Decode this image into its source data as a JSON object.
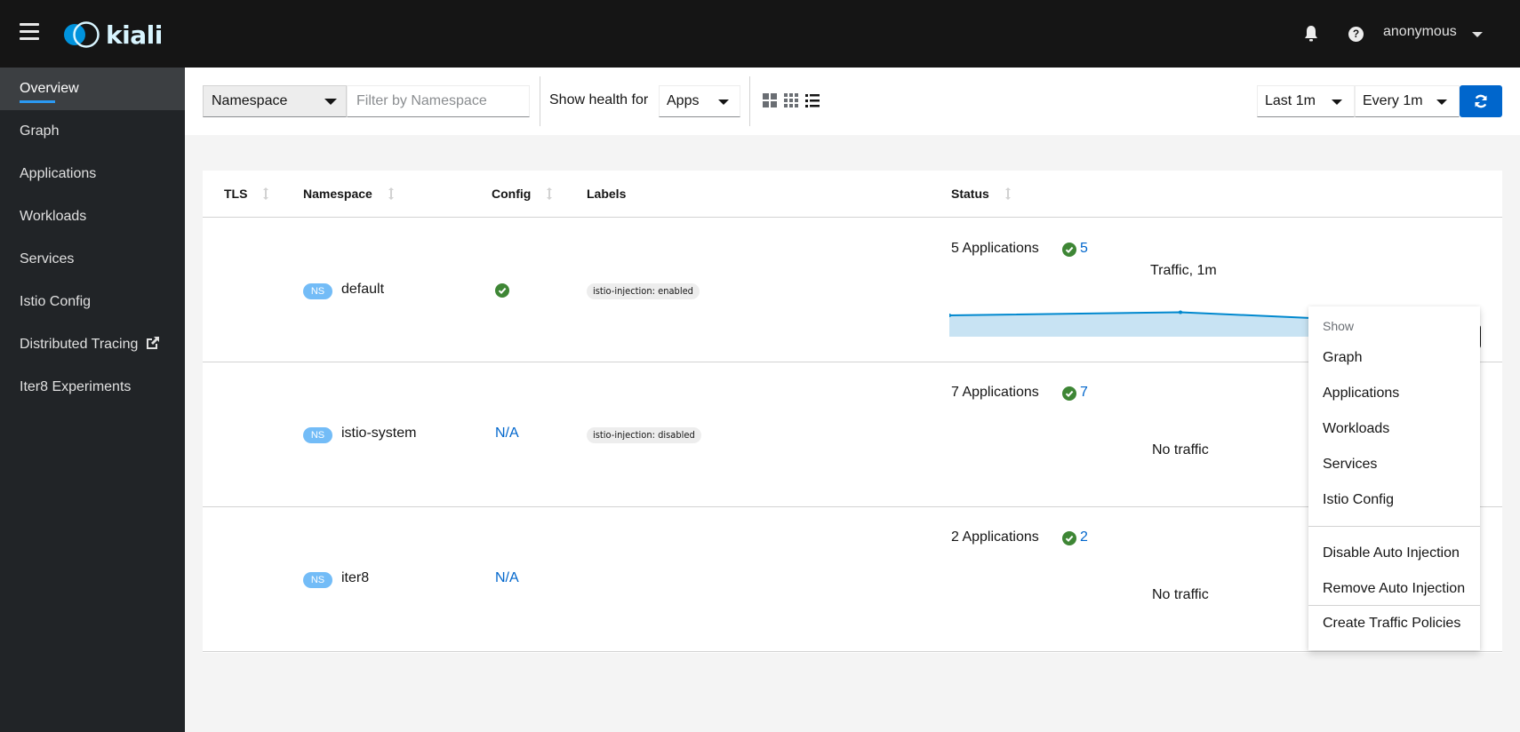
{
  "header": {
    "brand": "kiali",
    "user": "anonymous",
    "icons": [
      "hamburger-menu-icon",
      "kiali-logo",
      "bell-icon",
      "help-icon",
      "caret-down-icon"
    ]
  },
  "sidebar": {
    "items": [
      {
        "label": "Overview",
        "active": true
      },
      {
        "label": "Graph"
      },
      {
        "label": "Applications"
      },
      {
        "label": "Workloads"
      },
      {
        "label": "Services"
      },
      {
        "label": "Istio Config"
      },
      {
        "label": "Distributed Tracing",
        "icon": "external-link-icon"
      },
      {
        "label": "Iter8 Experiments"
      }
    ]
  },
  "toolbar": {
    "filter_type": "Namespace",
    "filter_placeholder": "Filter by Namespace",
    "filter_value": "",
    "health_label": "Show health for",
    "health_type": "Apps",
    "view_modes": [
      "expand-view-icon",
      "compact-view-icon",
      "list-view-icon"
    ],
    "duration": "Last 1m",
    "refresh_interval": "Every 1m",
    "refresh_icon": "sync-icon"
  },
  "table": {
    "columns": [
      "TLS",
      "Namespace",
      "Config",
      "Labels",
      "Status"
    ],
    "rows": [
      {
        "badge": "NS",
        "namespace": "default",
        "tls": "",
        "config": "ok",
        "config_text": "",
        "label": "istio-injection: enabled",
        "apps": "5 Applications",
        "healthy": "5",
        "traffic_title": "Traffic, 1m",
        "traffic_text": "",
        "has_chart": true
      },
      {
        "badge": "NS",
        "namespace": "istio-system",
        "tls": "",
        "config": "na",
        "config_text": "N/A",
        "label": "istio-injection: disabled",
        "apps": "7 Applications",
        "healthy": "7",
        "traffic_title": "",
        "traffic_text": "No traffic",
        "has_chart": false
      },
      {
        "badge": "NS",
        "namespace": "iter8",
        "tls": "",
        "config": "na",
        "config_text": "N/A",
        "label": "",
        "apps": "2 Applications",
        "healthy": "2",
        "traffic_title": "",
        "traffic_text": "No traffic",
        "has_chart": false
      }
    ]
  },
  "chart_data": {
    "type": "area",
    "title": "Traffic, 1m",
    "x": [
      0,
      1,
      2
    ],
    "values": [
      0.78,
      0.85,
      0.62
    ],
    "ylim": [
      0,
      1
    ],
    "xlabel": "",
    "ylabel": "",
    "grid": false,
    "color": "#0088ce",
    "fill": "#c8e3f3"
  },
  "kebab_menu": {
    "group_title": "Show",
    "show_items": [
      "Graph",
      "Applications",
      "Workloads",
      "Services",
      "Istio Config"
    ],
    "injection_items": [
      "Disable Auto Injection",
      "Remove Auto Injection"
    ],
    "policy_items": [
      "Create Traffic Policies"
    ]
  },
  "colors": {
    "masthead": "#151515",
    "sidebar": "#212427",
    "active_nav": "#3c3f42",
    "accent": "#0066cc",
    "ns_badge": "#73bcf7",
    "success": "#3e8635"
  }
}
